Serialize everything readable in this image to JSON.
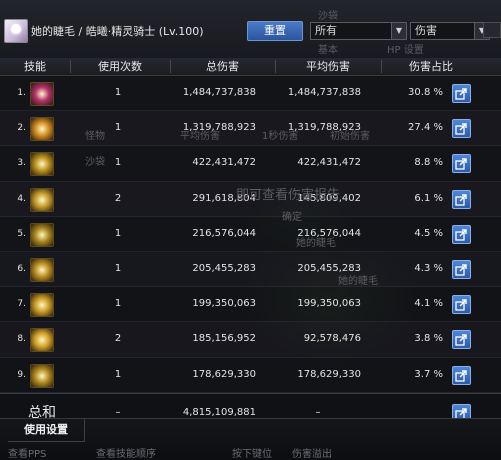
{
  "header": {
    "character_name": "她的睫毛 / 皓曦·精灵骑士 (Lv.100)",
    "reset_label": "重置",
    "filter_value": "所有",
    "stat_value": "伤害",
    "ghost_texts": [
      "沙袋",
      "基本",
      "HP 设置"
    ]
  },
  "columns": {
    "skill": "技能",
    "uses": "使用次数",
    "total": "总伤害",
    "average": "平均伤害",
    "share": "伤害占比"
  },
  "rows": [
    {
      "rank": "1.",
      "uses": "1",
      "total": "1,484,737,838",
      "average": "1,484,737,838",
      "percent": "30.8 %",
      "icon": "purple-burst-skill-icon",
      "color": "#b0306a"
    },
    {
      "rank": "2.",
      "uses": "1",
      "total": "1,319,788,923",
      "average": "1,319,788,923",
      "percent": "27.4 %",
      "icon": "golden-wings-skill-icon",
      "color": "#d08a20"
    },
    {
      "rank": "3.",
      "uses": "1",
      "total": "422,431,472",
      "average": "422,431,472",
      "percent": "8.8 %",
      "icon": "golden-spiral-skill-icon",
      "color": "#b8901c"
    },
    {
      "rank": "4.",
      "uses": "2",
      "total": "291,618,804",
      "average": "145,809,402",
      "percent": "6.1 %",
      "icon": "golden-slash-skill-icon",
      "color": "#c39a2a"
    },
    {
      "rank": "5.",
      "uses": "1",
      "total": "216,576,044",
      "average": "216,576,044",
      "percent": "4.5 %",
      "icon": "golden-shield-skill-icon",
      "color": "#a8861e"
    },
    {
      "rank": "6.",
      "uses": "1",
      "total": "205,455,283",
      "average": "205,455,283",
      "percent": "4.3 %",
      "icon": "golden-lance-skill-icon",
      "color": "#b88c22"
    },
    {
      "rank": "7.",
      "uses": "1",
      "total": "199,350,063",
      "average": "199,350,063",
      "percent": "4.1 %",
      "icon": "golden-claw-skill-icon",
      "color": "#c89a24"
    },
    {
      "rank": "8.",
      "uses": "2",
      "total": "185,156,952",
      "average": "92,578,476",
      "percent": "3.8 %",
      "icon": "golden-flare-skill-icon",
      "color": "#d0a028"
    },
    {
      "rank": "9.",
      "uses": "1",
      "total": "178,629,330",
      "average": "178,629,330",
      "percent": "3.7 %",
      "icon": "golden-rune-skill-icon",
      "color": "#b08820"
    }
  ],
  "summary": {
    "label": "总和",
    "uses": "–",
    "total": "4,815,109,881",
    "average": "–"
  },
  "footer": {
    "tab_label": "使用设置",
    "ghost_texts": [
      "查看PPS",
      "查看技能顺序",
      "按下键位",
      "伤害溢出"
    ]
  },
  "background": {
    "ghost_texts": [
      "怪物",
      "沙袋",
      "平均伤害",
      "1秒伤害",
      "初始伤害",
      "即可查看伤害报告",
      "确定",
      "她的睫毛",
      "她的睫毛"
    ]
  }
}
